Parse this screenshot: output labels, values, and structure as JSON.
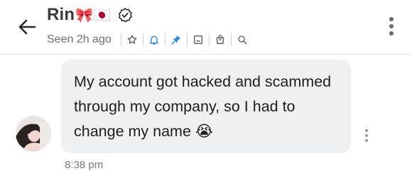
{
  "header": {
    "contact_name": "Rin",
    "name_emojis": "🎀🇯🇵",
    "last_seen": "Seen 2h ago",
    "icons": [
      "back-arrow-icon",
      "verified-badge-icon",
      "star-icon",
      "bell-icon",
      "pin-icon",
      "image-icon",
      "bag-icon",
      "search-icon",
      "more-vertical-icon"
    ],
    "pin_color": "#2b87e3"
  },
  "message": {
    "text": "My account got hacked and scammed through my company, so I had to change my name 😭",
    "timestamp": "8:38 pm",
    "bubble_color": "#eff0f2"
  }
}
